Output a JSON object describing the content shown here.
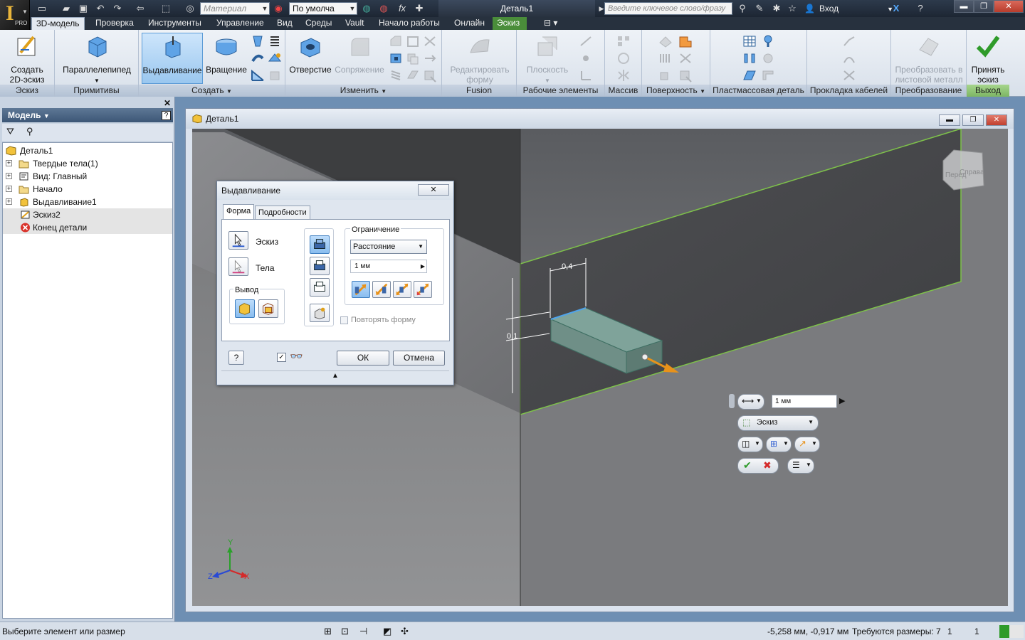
{
  "titlebar": {
    "material_placeholder": "Материал",
    "appearance_value": "По умолча",
    "document_title": "Деталь1",
    "search_placeholder": "Введите ключевое слово/фразу",
    "login": "Вход",
    "logo_label": "PRO"
  },
  "tabs": [
    "3D-модель",
    "Проверка",
    "Инструменты",
    "Управление",
    "Вид",
    "Среды",
    "Vault",
    "Начало работы",
    "Онлайн",
    "Эскиз"
  ],
  "ribbon": {
    "create_sketch": "Создать 2D-эскиз",
    "box": "Параллелепипед",
    "extrude": "Выдавливание",
    "revolve": "Вращение",
    "hole": "Отверстие",
    "fillet": "Сопряжение",
    "edit_form": "Редактировать форму",
    "plane": "Плоскость",
    "convert": "Преобразовать в листовой металл",
    "finish_sketch": "Принять эскиз",
    "panels": [
      "Эскиз",
      "Примитивы",
      "Создать",
      "Изменить",
      "Fusion",
      "Рабочие элементы",
      "Массив",
      "Поверхность",
      "Пластмассовая деталь",
      "Прокладка кабелей",
      "Преобразование",
      "Выход"
    ]
  },
  "browser": {
    "title": "Модель",
    "nodes": [
      "Деталь1",
      "Твердые тела(1)",
      "Вид: Главный",
      "Начало",
      "Выдавливание1",
      "Эскиз2",
      "Конец детали"
    ]
  },
  "mdi": {
    "title": "Деталь1"
  },
  "viewcube": {
    "front": "Перед",
    "right": "Справа"
  },
  "dimensions": {
    "width": "0,4",
    "height": "0,1"
  },
  "dialog": {
    "title": "Выдавливание",
    "tab_shape": "Форма",
    "tab_details": "Подробности",
    "profile": "Эскиз",
    "solids": "Тела",
    "output": "Вывод",
    "extents": "Ограничение",
    "extents_type": "Расстояние",
    "distance": "1 мм",
    "match_shape": "Повторять форму",
    "ok": "ОК",
    "cancel": "Отмена"
  },
  "minitoolbar": {
    "distance": "1 мм",
    "profile": "Эскиз"
  },
  "axes": {
    "x": "X",
    "y": "Y",
    "z": "Z"
  },
  "status": {
    "prompt": "Выберите элемент или размер",
    "coords": "-5,258 мм, -0,917 мм",
    "dims_needed": "Требуются размеры: 7",
    "count1": "1",
    "count2": "1"
  },
  "colors": {
    "accent": "#5c9bd6",
    "sketch_tab": "#4a8d3a",
    "edge": "#7ec24a",
    "arrow": "#e8921a"
  }
}
